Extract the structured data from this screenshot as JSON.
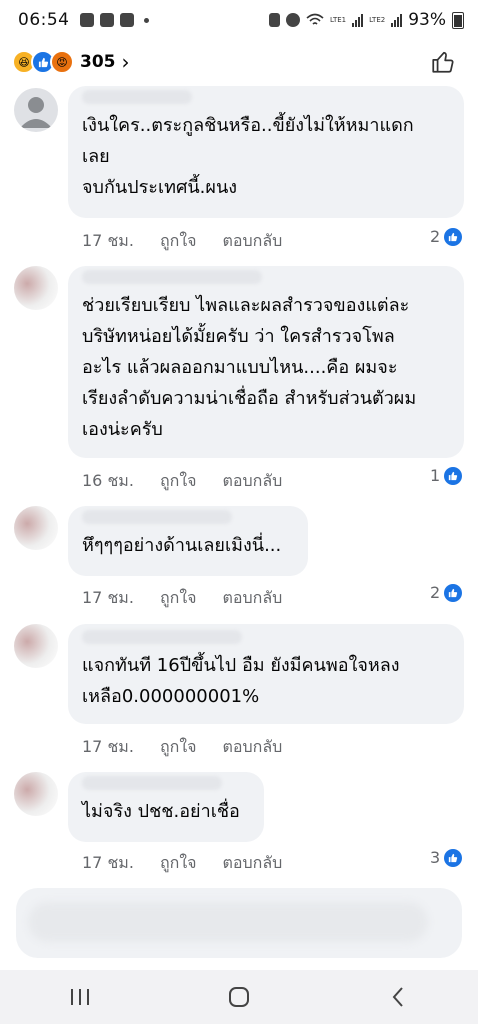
{
  "status_bar": {
    "time": "06:54",
    "battery": "93%",
    "sim1": "LTE1",
    "sim2": "LTE2"
  },
  "header": {
    "reactions": [
      "haha",
      "like",
      "angry"
    ],
    "reaction_count": "305",
    "chevron": "chevron-right-icon",
    "like_button_icon": "thumbs-up-outline-icon"
  },
  "comments": [
    {
      "text": "เงินใคร..ตระกูลชินหรือ..ขี้ยังไม่ให้หมาแดก\nเลย\nจบกันประเทศนี้.ผนง",
      "time": "17 ชม.",
      "like_label": "ถูกใจ",
      "reply_label": "ตอบกลับ",
      "likes": "2"
    },
    {
      "text": "ช่วยเรียบเรียบ ไพลและผลสำรวจของแต่ละ\nบริษัทหน่อยได้มั้ยครับ ว่า ใครสำรวจโพล\nอะไร แล้วผลออกมาแบบไหน....คือ ผมจะ\nเรียงลำดับความน่าเชื่อถือ สำหรับส่วนตัวผม\nเองน่ะครับ",
      "time": "16 ชม.",
      "like_label": "ถูกใจ",
      "reply_label": "ตอบกลับ",
      "likes": "1"
    },
    {
      "text": "หึๆๆๆอย่างด้านเลยเมิงนี่...",
      "time": "17 ชม.",
      "like_label": "ถูกใจ",
      "reply_label": "ตอบกลับ",
      "likes": "2"
    },
    {
      "text": "แจกทันที 16ปีขึ้นไป  อืม ยังมีคนพอใจหลง\nเหลือ0.000000001%",
      "time": "17 ชม.",
      "like_label": "ถูกใจ",
      "reply_label": "ตอบกลับ",
      "likes": ""
    },
    {
      "text": "ไม่จริง ปชช.อย่าเชื่อ",
      "time": "17 ชม.",
      "like_label": "ถูกใจ",
      "reply_label": "ตอบกลับ",
      "likes": "3"
    }
  ],
  "colors": {
    "bubble": "#f0f2f5",
    "meta_text": "#65676b",
    "like_blue": "#1b74e4"
  }
}
